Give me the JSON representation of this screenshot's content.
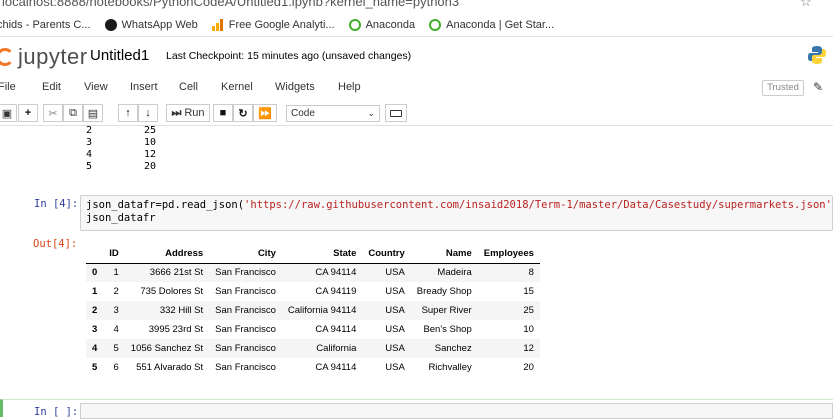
{
  "browser": {
    "url": "localhost:8888/notebooks/PythonCodeA/Untitled1.ipynb?kernel_name=python3",
    "bookmarks": [
      "chids - Parents C...",
      "WhatsApp Web",
      "Free Google Analyti...",
      "Anaconda",
      "Anaconda | Get Star..."
    ]
  },
  "header": {
    "logo_text": "jupyter",
    "notebook_title": "Untitled1",
    "checkpoint": "Last Checkpoint: 15 minutes ago  (unsaved changes)"
  },
  "menubar": {
    "items": [
      "File",
      "Edit",
      "View",
      "Insert",
      "Cell",
      "Kernel",
      "Widgets",
      "Help"
    ],
    "trusted": "Trusted"
  },
  "toolbar": {
    "run_label": "Run",
    "cell_type": "Code"
  },
  "previous_output": {
    "rows": [
      [
        "2",
        "25"
      ],
      [
        "3",
        "10"
      ],
      [
        "4",
        "12"
      ],
      [
        "5",
        "20"
      ]
    ]
  },
  "cell": {
    "in_prompt": "In [4]:",
    "out_prompt": "Out[4]:",
    "code_line1_prefix": "json_datafr=pd.read_json(",
    "code_line1_string": "'https://raw.githubusercontent.com/insaid2018/Term-1/master/Data/Casestudy/supermarkets.json'",
    "code_line1_suffix": ")",
    "code_line2": "json_datafr",
    "next_prompt": "In [ ]:"
  },
  "dataframe": {
    "columns": [
      "",
      "ID",
      "Address",
      "City",
      "State",
      "Country",
      "Name",
      "Employees"
    ],
    "rows": [
      [
        "0",
        "1",
        "3666 21st St",
        "San Francisco",
        "CA 94114",
        "USA",
        "Madeira",
        "8"
      ],
      [
        "1",
        "2",
        "735 Dolores St",
        "San Francisco",
        "CA 94119",
        "USA",
        "Bready Shop",
        "15"
      ],
      [
        "2",
        "3",
        "332 Hill St",
        "San Francisco",
        "California 94114",
        "USA",
        "Super River",
        "25"
      ],
      [
        "3",
        "4",
        "3995 23rd St",
        "San Francisco",
        "CA 94114",
        "USA",
        "Ben's Shop",
        "10"
      ],
      [
        "4",
        "5",
        "1056 Sanchez St",
        "San Francisco",
        "California",
        "USA",
        "Sanchez",
        "12"
      ],
      [
        "5",
        "6",
        "551 Alvarado St",
        "San Francisco",
        "CA 94114",
        "USA",
        "Richvalley",
        "20"
      ]
    ]
  }
}
